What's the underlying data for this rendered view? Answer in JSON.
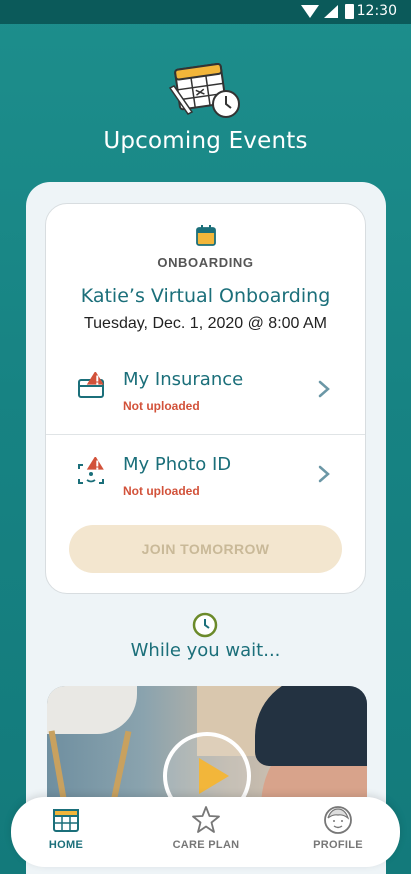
{
  "status_bar": {
    "time": "12:30"
  },
  "header": {
    "title": "Upcoming Events",
    "icon": "calendar-clock-icon"
  },
  "event": {
    "type": "ONBOARDING",
    "name": "Katie’s Virtual Onboarding",
    "datetime": "Tuesday, Dec. 1, 2020 @ 8:00 AM",
    "documents": [
      {
        "title": "My Insurance",
        "status": "Not uploaded",
        "icon": "insurance-card-icon"
      },
      {
        "title": "My Photo ID",
        "status": "Not uploaded",
        "icon": "photo-id-icon"
      }
    ],
    "join_label": "JOIN TOMORROW"
  },
  "wait_section": {
    "title": "While you wait..."
  },
  "nav": {
    "items": [
      {
        "label": "HOME",
        "icon": "home-calendar-icon"
      },
      {
        "label": "CARE PLAN",
        "icon": "star-icon"
      },
      {
        "label": "PROFILE",
        "icon": "profile-face-icon"
      }
    ]
  },
  "colors": {
    "background": "#178383",
    "panel": "#eef4f7",
    "title_teal": "#1b6f7a",
    "warning_red": "#d2523a",
    "join_button_bg": "#f3e6cf",
    "join_button_text": "#c9b998",
    "nav_active": "#1b6f7a",
    "nav_inactive": "#777777",
    "accent_gold": "#f2b63a"
  }
}
